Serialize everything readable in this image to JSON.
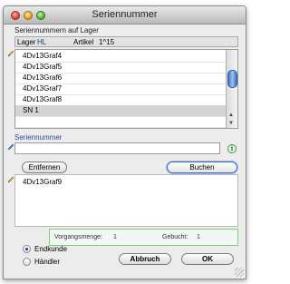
{
  "window": {
    "title": "Seriennummer"
  },
  "top_group": {
    "label": "Seriennummern auf Lager",
    "lager_label": "Lager",
    "lager_value": "HL",
    "artikel_label": "Artikel",
    "artikel_value": "1^15",
    "items": [
      "4Dv13Graf4",
      "4Dv13Graf5",
      "4Dv13Graf6",
      "4Dv13Graf7",
      "4Dv13Graf8",
      "SN 1"
    ],
    "selected_index": 5
  },
  "entry": {
    "label": "Seriennummer",
    "value": "",
    "remove_button": "Entfernen",
    "book_button": "Buchen"
  },
  "booked_list": {
    "items": [
      "4Dv13Graf9"
    ]
  },
  "status": {
    "vorgang_label": "Vorgangsmenge:",
    "vorgang_value": "1",
    "gebucht_label": "Gebucht:",
    "gebucht_value": "1"
  },
  "radios": {
    "options": [
      "Endkunde",
      "Händler"
    ],
    "selected": "Endkunde"
  },
  "buttons": {
    "cancel": "Abbruch",
    "ok": "OK"
  },
  "colors": {
    "accent": "#3b6cc0",
    "status_border": "#7fcf7f"
  }
}
